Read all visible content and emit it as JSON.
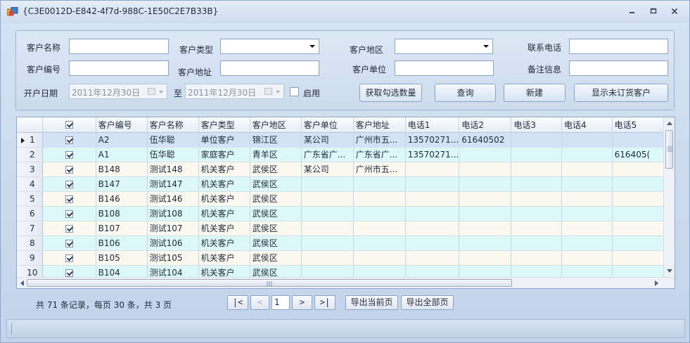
{
  "window": {
    "title": "{C3E0012D-E842-4f7d-988C-1E50C2E7B33B}"
  },
  "colors": {
    "row_even": "#fbf9ef",
    "row_odd": "#ddf8f8",
    "row_selected": "#d4e2f6",
    "window_bg": "#c9d8ec"
  },
  "search": {
    "customer_name_label": "客户名称",
    "customer_name_value": "",
    "customer_type_label": "客户类型",
    "customer_type_value": "",
    "customer_region_label": "客户地区",
    "customer_region_value": "",
    "phone_label": "联系电话",
    "phone_value": "",
    "customer_code_label": "客户编号",
    "customer_code_value": "",
    "customer_address_label": "客户地址",
    "customer_address_value": "",
    "customer_company_label": "客户单位",
    "customer_company_value": "",
    "note_label": "备注信息",
    "note_value": "",
    "open_date_label": "开户日期",
    "date_from": "2011年12月30日",
    "date_to_label": "至",
    "date_to": "2011年12月30日",
    "enable_label": "启用",
    "enable_checked": false
  },
  "buttons": {
    "get_checked": "获取勾选数量",
    "query": "查询",
    "new": "新建",
    "show_unordered": "显示未订货客户"
  },
  "grid": {
    "columns": [
      "",
      "",
      "客户编号",
      "客户名称",
      "客户类型",
      "客户地区",
      "客户单位",
      "客户地址",
      "电话1",
      "电话2",
      "电话3",
      "电话4",
      "电话5"
    ],
    "rows": [
      {
        "num": "1",
        "checked": true,
        "code": "A2",
        "name": "伍华聪",
        "type": "单位客户",
        "region": "锦江区",
        "company": "某公司",
        "address": "广州市五...",
        "phone1": "13570271...",
        "phone2": "61640502",
        "phone3": "",
        "phone4": "",
        "phone5": ""
      },
      {
        "num": "2",
        "checked": true,
        "code": "A1",
        "name": "伍华聪",
        "type": "家庭客户",
        "region": "青羊区",
        "company": "广东省广...",
        "address": "广东省广...",
        "phone1": "13570271...",
        "phone2": "",
        "phone3": "",
        "phone4": "",
        "phone5": "616405("
      },
      {
        "num": "3",
        "checked": true,
        "code": "B148",
        "name": "测试148",
        "type": "机关客户",
        "region": "武侯区",
        "company": "某公司",
        "address": "广州市五...",
        "phone1": "",
        "phone2": "",
        "phone3": "",
        "phone4": "",
        "phone5": ""
      },
      {
        "num": "4",
        "checked": true,
        "code": "B147",
        "name": "测试147",
        "type": "机关客户",
        "region": "武侯区",
        "company": "",
        "address": "",
        "phone1": "",
        "phone2": "",
        "phone3": "",
        "phone4": "",
        "phone5": ""
      },
      {
        "num": "5",
        "checked": true,
        "code": "B146",
        "name": "测试146",
        "type": "机关客户",
        "region": "武侯区",
        "company": "",
        "address": "",
        "phone1": "",
        "phone2": "",
        "phone3": "",
        "phone4": "",
        "phone5": ""
      },
      {
        "num": "6",
        "checked": true,
        "code": "B108",
        "name": "测试108",
        "type": "机关客户",
        "region": "武侯区",
        "company": "",
        "address": "",
        "phone1": "",
        "phone2": "",
        "phone3": "",
        "phone4": "",
        "phone5": ""
      },
      {
        "num": "7",
        "checked": true,
        "code": "B107",
        "name": "测试107",
        "type": "机关客户",
        "region": "武侯区",
        "company": "",
        "address": "",
        "phone1": "",
        "phone2": "",
        "phone3": "",
        "phone4": "",
        "phone5": ""
      },
      {
        "num": "8",
        "checked": true,
        "code": "B106",
        "name": "测试106",
        "type": "机关客户",
        "region": "武侯区",
        "company": "",
        "address": "",
        "phone1": "",
        "phone2": "",
        "phone3": "",
        "phone4": "",
        "phone5": ""
      },
      {
        "num": "9",
        "checked": true,
        "code": "B105",
        "name": "测试105",
        "type": "机关客户",
        "region": "武侯区",
        "company": "",
        "address": "",
        "phone1": "",
        "phone2": "",
        "phone3": "",
        "phone4": "",
        "phone5": ""
      },
      {
        "num": "10",
        "checked": true,
        "code": "B104",
        "name": "测试104",
        "type": "机关客户",
        "region": "武侯区",
        "company": "",
        "address": "",
        "phone1": "",
        "phone2": "",
        "phone3": "",
        "phone4": "",
        "phone5": ""
      }
    ]
  },
  "pager": {
    "info": "共 71 条记录，每页 30 条，共 3 页",
    "first": "|<",
    "prev": "<",
    "page": "1",
    "next": ">",
    "last": ">|",
    "export_current": "导出当前页",
    "export_all": "导出全部页"
  }
}
